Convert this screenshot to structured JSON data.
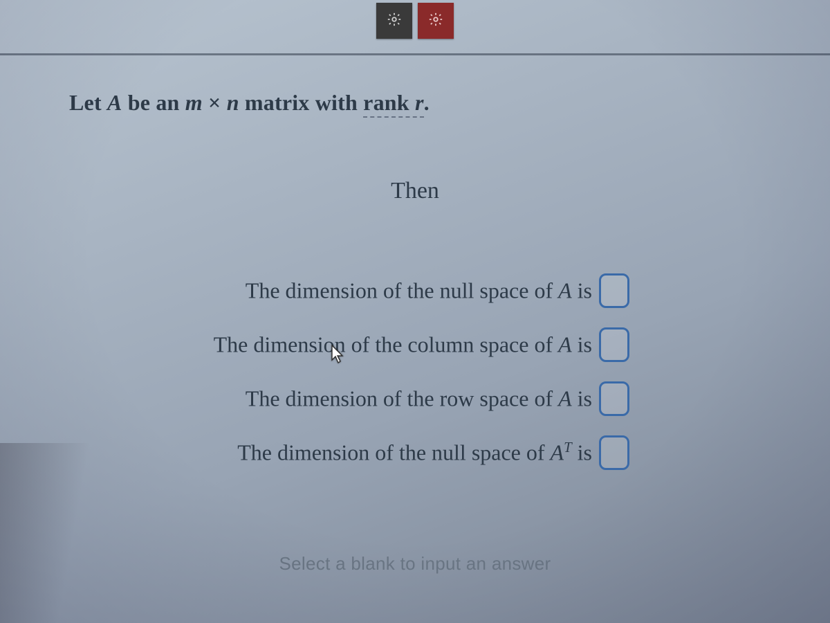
{
  "toolbar": {
    "buttons": [
      {
        "name": "tool-button-1",
        "icon": "gear-icon",
        "color": "dark"
      },
      {
        "name": "tool-button-2",
        "icon": "gear-icon",
        "color": "red"
      }
    ]
  },
  "question": {
    "intro_prefix": "Let ",
    "intro_A": "A",
    "intro_mid1": " be an ",
    "intro_m": "m",
    "intro_times": " × ",
    "intro_n": "n",
    "intro_mid2": " matrix with ",
    "intro_rank_word": "rank ",
    "intro_r": "r",
    "intro_suffix": ".",
    "then": "Then",
    "statements": [
      {
        "text_prefix": "The dimension of the null space of ",
        "symbol": "A",
        "sup": "",
        "text_suffix": " is"
      },
      {
        "text_prefix": "The dimension of the column space of ",
        "symbol": "A",
        "sup": "",
        "text_suffix": " is"
      },
      {
        "text_prefix": "The dimension of the row space of ",
        "symbol": "A",
        "sup": "",
        "text_suffix": " is"
      },
      {
        "text_prefix": "The dimension of the null space of ",
        "symbol": "A",
        "sup": "T",
        "text_suffix": " is"
      }
    ],
    "hint": "Select a blank to input an answer"
  },
  "colors": {
    "answer_box_border": "#3a6aa8",
    "text": "#2d3a48",
    "hint": "#6a7684",
    "tool_dark": "#3a3a3a",
    "tool_red": "#8a2a2a"
  }
}
